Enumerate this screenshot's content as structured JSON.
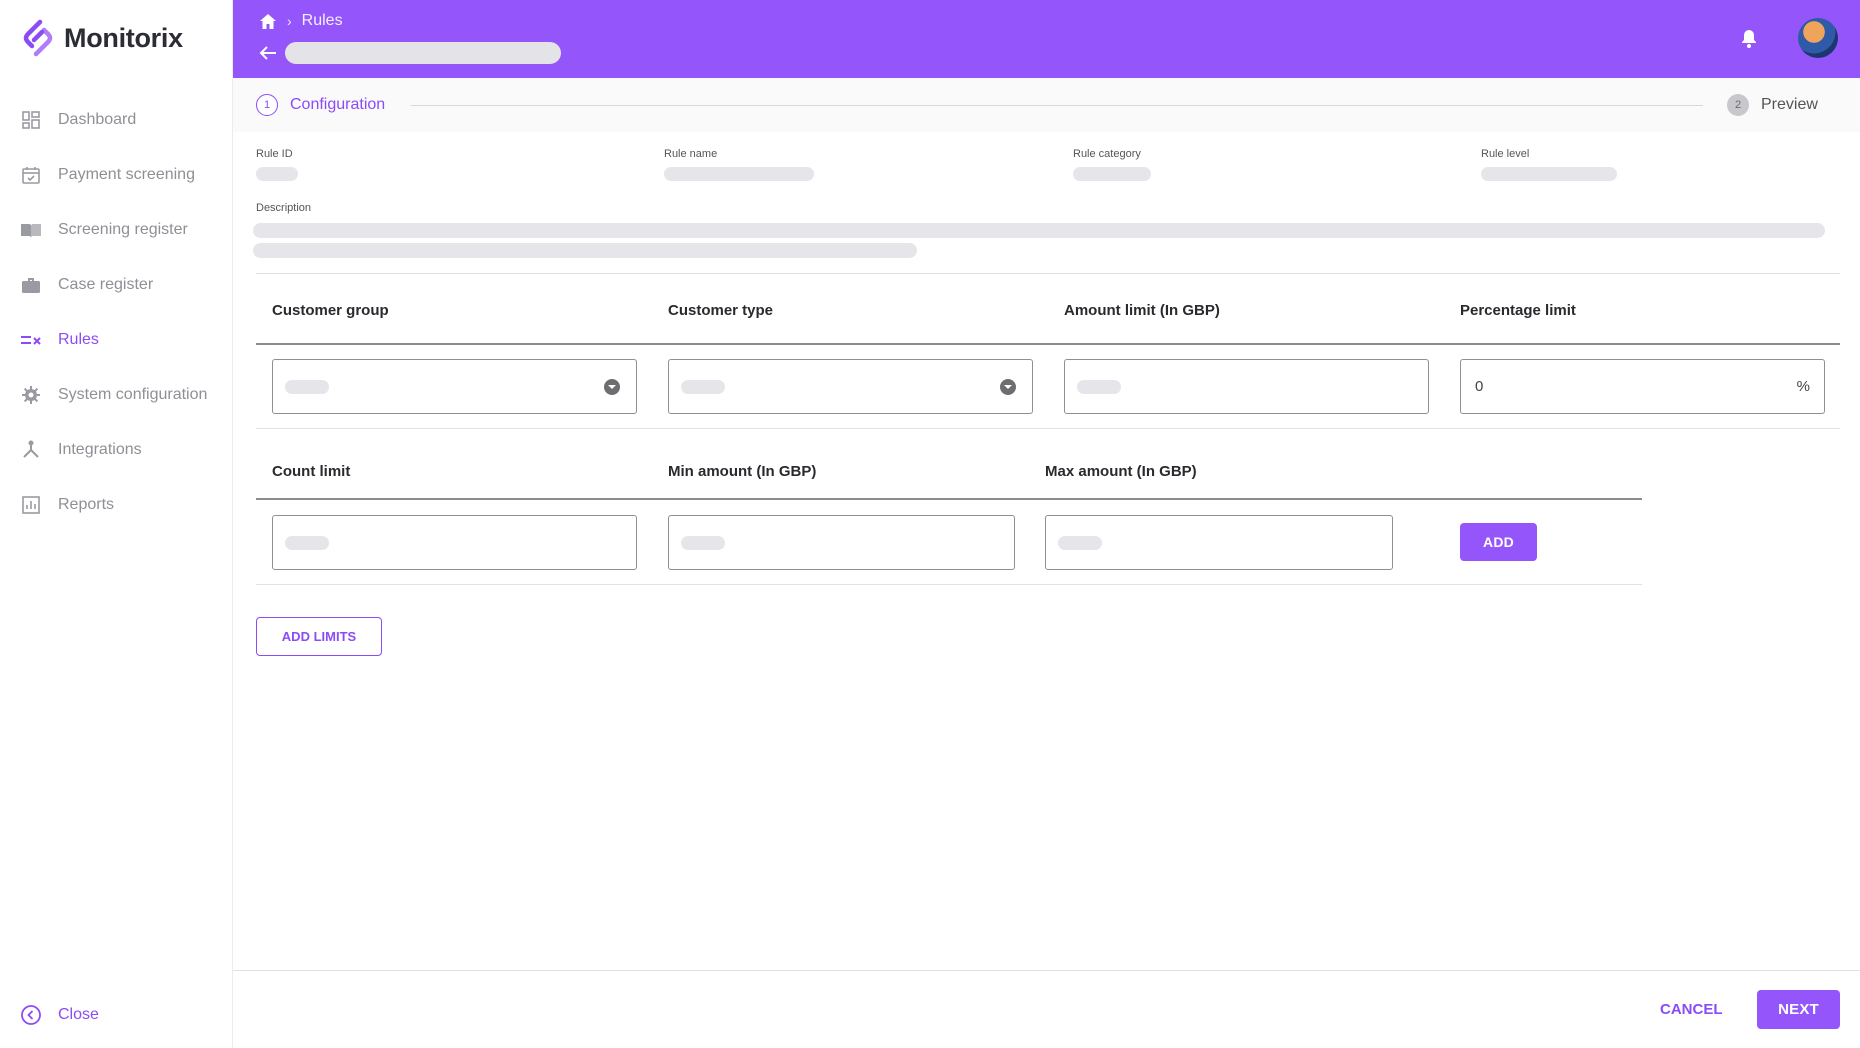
{
  "app": {
    "name": "Monitorix",
    "brand_color": "#9456fb"
  },
  "sidebar": {
    "items": [
      {
        "label": "Dashboard",
        "icon": "dashboard-icon"
      },
      {
        "label": "Payment screening",
        "icon": "calendar-check-icon"
      },
      {
        "label": "Screening register",
        "icon": "book-icon"
      },
      {
        "label": "Case register",
        "icon": "briefcase-icon"
      },
      {
        "label": "Rules",
        "icon": "rules-icon",
        "active": true
      },
      {
        "label": "System configuration",
        "icon": "gear-icon"
      },
      {
        "label": "Integrations",
        "icon": "integrations-icon"
      },
      {
        "label": "Reports",
        "icon": "chart-icon"
      }
    ],
    "close_label": "Close"
  },
  "header": {
    "breadcrumb": {
      "current": "Rules"
    }
  },
  "stepper": {
    "steps": [
      {
        "number": "1",
        "label": "Configuration"
      },
      {
        "number": "2",
        "label": "Preview"
      }
    ]
  },
  "meta": {
    "rule_id_label": "Rule ID",
    "rule_name_label": "Rule name",
    "rule_category_label": "Rule category",
    "rule_level_label": "Rule level",
    "description_label": "Description"
  },
  "limits": {
    "row1": {
      "customer_group": "Customer group",
      "customer_type": "Customer type",
      "amount_limit": "Amount limit (In GBP)",
      "percentage_limit": "Percentage limit",
      "percentage_value": "0",
      "percentage_suffix": "%"
    },
    "row2": {
      "count_limit": "Count limit",
      "min_amount": "Min amount (In GBP)",
      "max_amount": "Max amount (In GBP)"
    },
    "add_label": "ADD",
    "add_limits_label": "ADD LIMITS"
  },
  "footer": {
    "cancel_label": "CANCEL",
    "next_label": "NEXT"
  }
}
